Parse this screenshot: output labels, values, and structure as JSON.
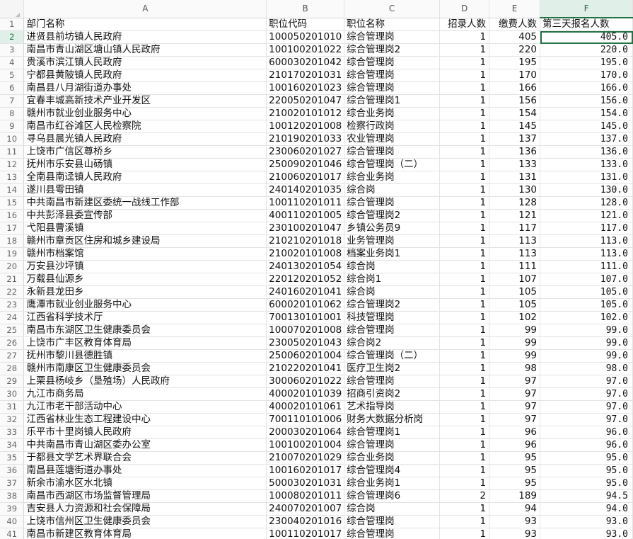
{
  "sheet": {
    "columns": [
      "A",
      "B",
      "C",
      "D",
      "E",
      "F"
    ],
    "selected_column": "F",
    "selected_row": "2",
    "rows": [
      {
        "n": "1",
        "a": "部门名称",
        "b": "职位代码",
        "c": "职位名称",
        "d": "招录人数",
        "e": "缴费人数",
        "f": "第三天报名人数"
      },
      {
        "n": "2",
        "a": "进贤县前坊镇人民政府",
        "b": "100050201010",
        "c": "综合管理岗",
        "d": "1",
        "e": "405",
        "f": "405.0"
      },
      {
        "n": "3",
        "a": "南昌市青山湖区塘山镇人民政府",
        "b": "100100201022",
        "c": "综合管理岗2",
        "d": "1",
        "e": "220",
        "f": "220.0"
      },
      {
        "n": "4",
        "a": "贵溪市滨江镇人民政府",
        "b": "600030201042",
        "c": "综合管理岗",
        "d": "1",
        "e": "195",
        "f": "195.0"
      },
      {
        "n": "5",
        "a": "宁都县黄陂镇人民政府",
        "b": "210170201031",
        "c": "综合管理岗",
        "d": "1",
        "e": "170",
        "f": "170.0"
      },
      {
        "n": "6",
        "a": "南昌县八月湖街道办事处",
        "b": "100160201023",
        "c": "综合管理岗",
        "d": "1",
        "e": "166",
        "f": "166.0"
      },
      {
        "n": "7",
        "a": "宜春丰城高新技术产业开发区",
        "b": "220050201047",
        "c": "综合管理岗1",
        "d": "1",
        "e": "156",
        "f": "156.0"
      },
      {
        "n": "8",
        "a": "赣州市就业创业服务中心",
        "b": "210020101012",
        "c": "综合业务岗",
        "d": "1",
        "e": "154",
        "f": "154.0"
      },
      {
        "n": "9",
        "a": "南昌市红谷滩区人民检察院",
        "b": "100120201008",
        "c": "检察行政岗",
        "d": "1",
        "e": "145",
        "f": "145.0"
      },
      {
        "n": "10",
        "a": "寻乌县晨光镇人民政府",
        "b": "210190201033",
        "c": "农业管理岗",
        "d": "1",
        "e": "137",
        "f": "137.0"
      },
      {
        "n": "11",
        "a": "上饶市广信区尊桥乡",
        "b": "230060201027",
        "c": "综合管理岗",
        "d": "1",
        "e": "136",
        "f": "136.0"
      },
      {
        "n": "12",
        "a": "抚州市乐安县山砀镇",
        "b": "250090201046",
        "c": "综合管理岗（二）",
        "d": "1",
        "e": "133",
        "f": "133.0"
      },
      {
        "n": "13",
        "a": "全南县南迳镇人民政府",
        "b": "210060201017",
        "c": "综合业务岗",
        "d": "1",
        "e": "131",
        "f": "131.0"
      },
      {
        "n": "14",
        "a": "遂川县雩田镇",
        "b": "240140201035",
        "c": "综合岗",
        "d": "1",
        "e": "130",
        "f": "130.0"
      },
      {
        "n": "15",
        "a": "中共南昌市新建区委统一战线工作部",
        "b": "100110201011",
        "c": "综合管理岗",
        "d": "1",
        "e": "128",
        "f": "128.0"
      },
      {
        "n": "16",
        "a": "中共彭泽县委宣传部",
        "b": "400110201005",
        "c": "综合管理岗2",
        "d": "1",
        "e": "121",
        "f": "121.0"
      },
      {
        "n": "17",
        "a": "弋阳县曹溪镇",
        "b": "230100201047",
        "c": "乡镇公务员9",
        "d": "1",
        "e": "117",
        "f": "117.0"
      },
      {
        "n": "18",
        "a": "赣州市章贡区住房和城乡建设局",
        "b": "210210201018",
        "c": "业务管理岗",
        "d": "1",
        "e": "113",
        "f": "113.0"
      },
      {
        "n": "19",
        "a": "赣州市档案馆",
        "b": "210020101008",
        "c": "档案业务岗1",
        "d": "1",
        "e": "113",
        "f": "113.0"
      },
      {
        "n": "20",
        "a": "万安县沙坪镇",
        "b": "240130201054",
        "c": "综合岗",
        "d": "1",
        "e": "111",
        "f": "111.0"
      },
      {
        "n": "21",
        "a": "万载县仙源乡",
        "b": "220120201052",
        "c": "综合岗1",
        "d": "1",
        "e": "107",
        "f": "107.0"
      },
      {
        "n": "22",
        "a": "永新县龙田乡",
        "b": "240160201041",
        "c": "综合岗",
        "d": "1",
        "e": "105",
        "f": "105.0"
      },
      {
        "n": "23",
        "a": "鹰潭市就业创业服务中心",
        "b": "600020101062",
        "c": "综合管理岗2",
        "d": "1",
        "e": "105",
        "f": "105.0"
      },
      {
        "n": "24",
        "a": "江西省科学技术厅",
        "b": "700130101001",
        "c": "科技管理岗",
        "d": "1",
        "e": "102",
        "f": "102.0"
      },
      {
        "n": "25",
        "a": "南昌市东湖区卫生健康委员会",
        "b": "100070201008",
        "c": "综合管理岗",
        "d": "1",
        "e": "99",
        "f": "99.0"
      },
      {
        "n": "26",
        "a": "上饶市广丰区教育体育局",
        "b": "230050201043",
        "c": "综合岗2",
        "d": "1",
        "e": "99",
        "f": "99.0"
      },
      {
        "n": "27",
        "a": "抚州市黎川县德胜镇",
        "b": "250060201004",
        "c": "综合管理岗（二）",
        "d": "1",
        "e": "99",
        "f": "99.0"
      },
      {
        "n": "28",
        "a": "赣州市南康区卫生健康委员会",
        "b": "210220201041",
        "c": "医疗卫生岗2",
        "d": "1",
        "e": "98",
        "f": "98.0"
      },
      {
        "n": "29",
        "a": "上栗县杨岐乡（垦殖场）人民政府",
        "b": "300060201022",
        "c": "综合管理岗",
        "d": "1",
        "e": "97",
        "f": "97.0"
      },
      {
        "n": "30",
        "a": "九江市商务局",
        "b": "400020101039",
        "c": "招商引资岗2",
        "d": "1",
        "e": "97",
        "f": "97.0"
      },
      {
        "n": "31",
        "a": "九江市老干部活动中心",
        "b": "400020101061",
        "c": "艺术指导岗",
        "d": "1",
        "e": "97",
        "f": "97.0"
      },
      {
        "n": "32",
        "a": "江西省林业生态工程建设中心",
        "b": "700110101006",
        "c": "财务大数据分析岗",
        "d": "1",
        "e": "97",
        "f": "97.0"
      },
      {
        "n": "33",
        "a": "乐平市十里岗镇人民政府",
        "b": "200030201064",
        "c": "综合管理岗1",
        "d": "1",
        "e": "96",
        "f": "96.0"
      },
      {
        "n": "34",
        "a": "中共南昌市青山湖区委办公室",
        "b": "100100201004",
        "c": "综合管理岗",
        "d": "1",
        "e": "96",
        "f": "96.0"
      },
      {
        "n": "35",
        "a": "于都县文学艺术界联合会",
        "b": "210070201029",
        "c": "综合业务岗",
        "d": "1",
        "e": "95",
        "f": "95.0"
      },
      {
        "n": "36",
        "a": "南昌县莲塘街道办事处",
        "b": "100160201017",
        "c": "综合管理岗4",
        "d": "1",
        "e": "95",
        "f": "95.0"
      },
      {
        "n": "37",
        "a": "新余市渝水区水北镇",
        "b": "500030201031",
        "c": "综合业务岗1",
        "d": "1",
        "e": "95",
        "f": "95.0"
      },
      {
        "n": "38",
        "a": "南昌市西湖区市场监督管理局",
        "b": "100080201011",
        "c": "综合管理岗6",
        "d": "2",
        "e": "189",
        "f": "94.5"
      },
      {
        "n": "39",
        "a": "吉安县人力资源和社会保障局",
        "b": "240070201007",
        "c": "综合岗",
        "d": "1",
        "e": "94",
        "f": "94.0"
      },
      {
        "n": "40",
        "a": "上饶市信州区卫生健康委员会",
        "b": "230040201016",
        "c": "综合管理岗",
        "d": "1",
        "e": "93",
        "f": "93.0"
      },
      {
        "n": "41",
        "a": "南昌市新建区教育体育局",
        "b": "100110201017",
        "c": "综合管理岗",
        "d": "1",
        "e": "93",
        "f": "93.0"
      }
    ]
  }
}
